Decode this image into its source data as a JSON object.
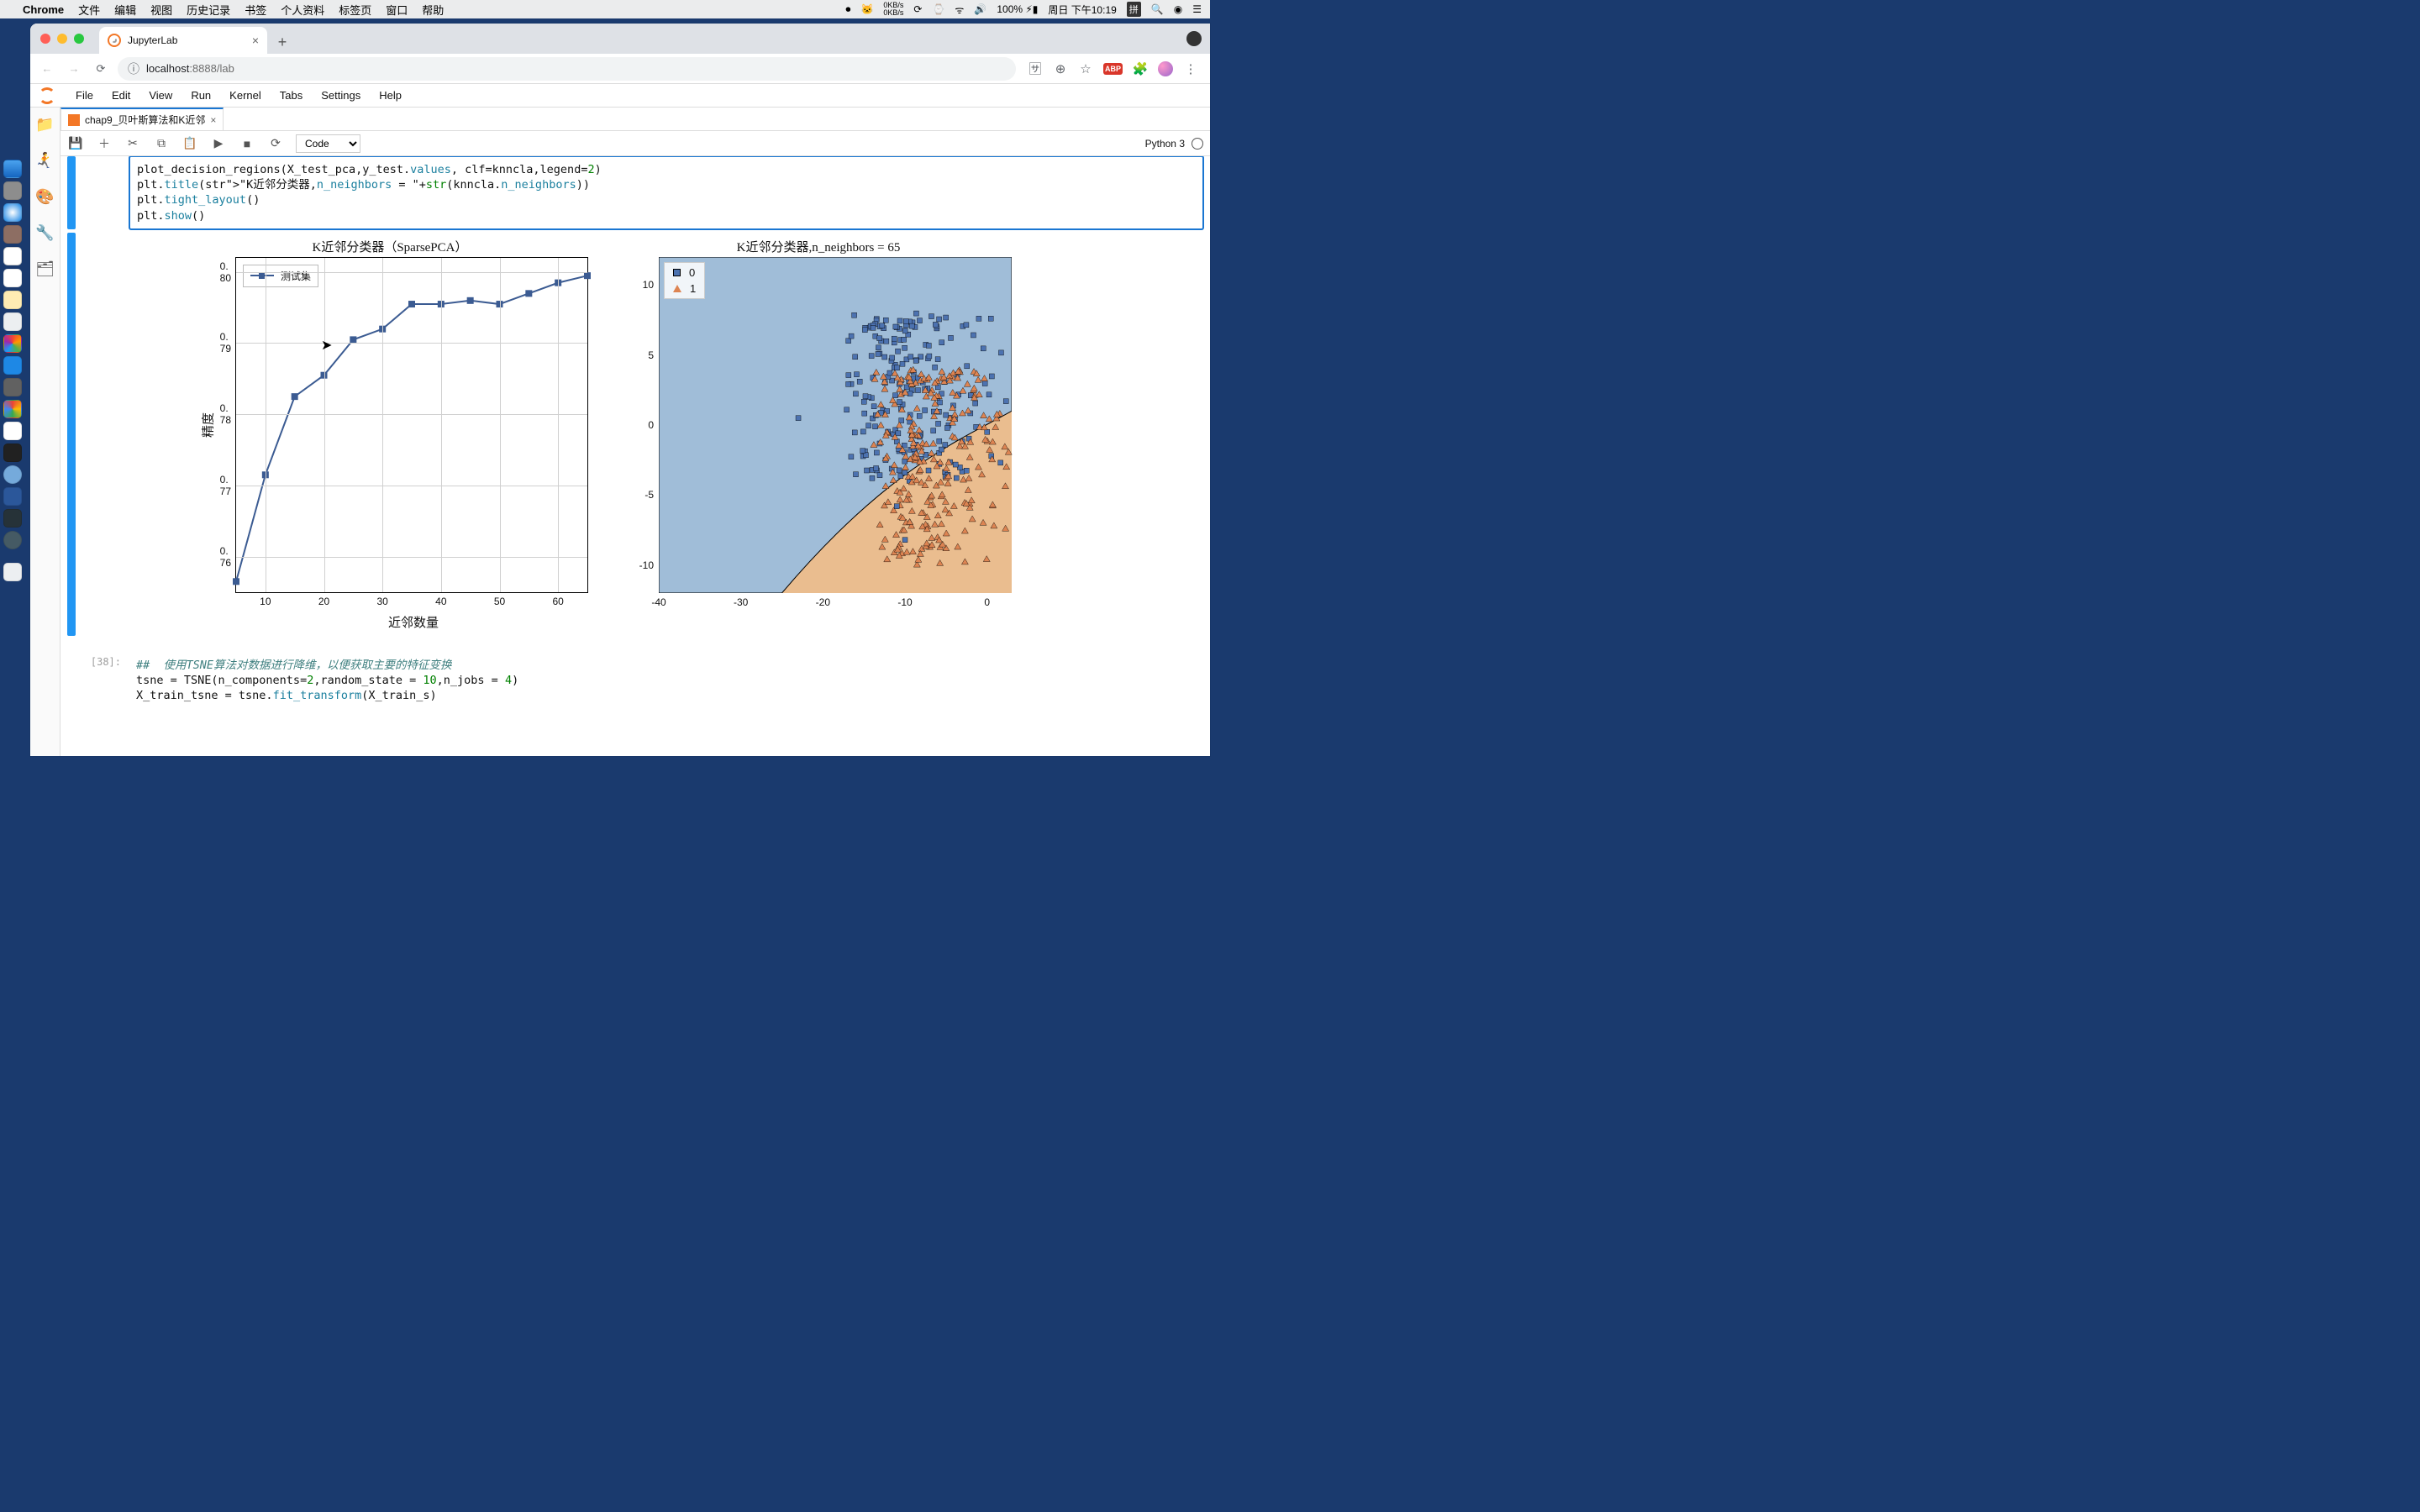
{
  "mac": {
    "app": "Chrome",
    "menus": [
      "文件",
      "编辑",
      "视图",
      "历史记录",
      "书签",
      "个人资料",
      "标签页",
      "窗口",
      "帮助"
    ],
    "net_up": "0KB/s",
    "net_down": "0KB/s",
    "battery": "100%",
    "day_time": "周日 下午10:19",
    "input_method": "拼"
  },
  "chrome": {
    "tab_title": "JupyterLab",
    "url_host": "localhost",
    "url_port_path": ":8888/lab"
  },
  "jlab": {
    "menus": [
      "File",
      "Edit",
      "View",
      "Run",
      "Kernel",
      "Tabs",
      "Settings",
      "Help"
    ],
    "tab_name": "chap9_贝叶斯算法和K近邻",
    "celltype": "Code",
    "kernel": "Python 3"
  },
  "code_cell_top": {
    "lines": [
      "plot_decision_regions(X_test_pca,y_test.values, clf=knncla,legend=2)",
      "plt.title(\"K近邻分类器,n_neighbors = \"+str(knncla.n_neighbors))",
      "plt.tight_layout()",
      "plt.show()"
    ]
  },
  "next_cell": {
    "prompt": "[38]:",
    "lines": [
      "##  使用TSNE算法对数据进行降维，以便获取主要的特征变换",
      "tsne = TSNE(n_components=2,random_state = 10,n_jobs = 4)",
      "X_train_tsne = tsne.fit_transform(X_train_s)"
    ]
  },
  "chart_data": [
    {
      "type": "line",
      "title": "K近邻分类器（SparsePCA）",
      "xlabel": "近邻数量",
      "ylabel": "精度",
      "legend": "测试集",
      "x": [
        5,
        10,
        15,
        20,
        25,
        30,
        35,
        40,
        45,
        50,
        55,
        60,
        65
      ],
      "y": [
        0.7565,
        0.7715,
        0.7825,
        0.7855,
        0.7905,
        0.792,
        0.7955,
        0.7955,
        0.796,
        0.7955,
        0.797,
        0.7985,
        0.7995
      ],
      "xlim": [
        5,
        65
      ],
      "ylim": [
        0.755,
        0.802
      ],
      "xticks": [
        10,
        20,
        30,
        40,
        50,
        60
      ],
      "yticks": [
        0.76,
        0.77,
        0.78,
        0.79,
        0.8
      ],
      "ytick_labels": [
        "0. 76",
        "0. 77",
        "0. 78",
        "0. 79",
        "0. 80"
      ]
    },
    {
      "type": "scatter",
      "title": "K近邻分类器,n_neighbors = 65",
      "legend": [
        "0",
        "1"
      ],
      "xlim": [
        -40,
        3
      ],
      "ylim": [
        -12,
        12
      ],
      "xticks": [
        -40,
        -30,
        -20,
        -10,
        0
      ],
      "yticks": [
        -10,
        -5,
        0,
        5,
        10
      ],
      "note": "dense two-class scatter with decision regions"
    }
  ]
}
